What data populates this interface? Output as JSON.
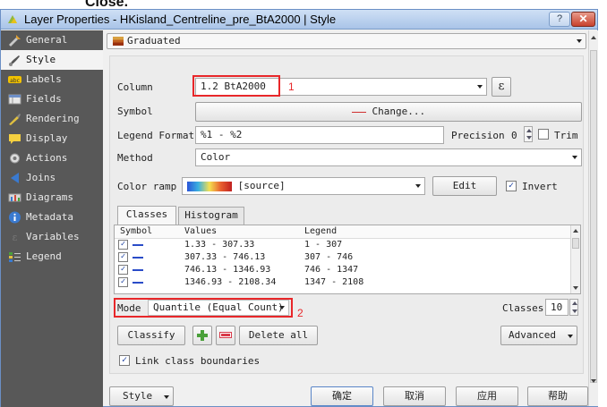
{
  "top_label": "Close.",
  "window": {
    "title": "Layer Properties - HKisland_Centreline_pre_BtA2000 | Style",
    "help": "?",
    "close": "✕"
  },
  "sidebar": {
    "items": [
      {
        "label": "General",
        "icon": "general-icon"
      },
      {
        "label": "Style",
        "icon": "style-icon"
      },
      {
        "label": "Labels",
        "icon": "labels-icon"
      },
      {
        "label": "Fields",
        "icon": "fields-icon"
      },
      {
        "label": "Rendering",
        "icon": "rendering-icon"
      },
      {
        "label": "Display",
        "icon": "display-icon"
      },
      {
        "label": "Actions",
        "icon": "actions-icon"
      },
      {
        "label": "Joins",
        "icon": "joins-icon"
      },
      {
        "label": "Diagrams",
        "icon": "diagrams-icon"
      },
      {
        "label": "Metadata",
        "icon": "metadata-icon"
      },
      {
        "label": "Variables",
        "icon": "variables-icon"
      },
      {
        "label": "Legend",
        "icon": "legend-icon"
      }
    ],
    "active_index": 1
  },
  "renderer": {
    "label": "Graduated"
  },
  "form": {
    "column_label": "Column",
    "column_value": "1.2 BtA2000",
    "epsilon": "ε",
    "symbol_label": "Symbol",
    "change_button": "Change...",
    "legend_format_label": "Legend Format",
    "legend_format_value": "%1 - %2",
    "precision_label": "Precision",
    "precision_value": "0",
    "trim_label": "Trim",
    "method_label": "Method",
    "method_value": "Color",
    "color_ramp_label": "Color ramp",
    "color_ramp_value": "[source]",
    "edit_button": "Edit",
    "invert_label": "Invert"
  },
  "annotations": {
    "n1": "1",
    "n2": "2"
  },
  "tabs": [
    {
      "label": "Classes"
    },
    {
      "label": "Histogram"
    }
  ],
  "classes_table": {
    "headers": [
      "Symbol",
      "Values",
      "Legend"
    ],
    "rows": [
      {
        "values": "1.33 - 307.33",
        "legend": "1 - 307"
      },
      {
        "values": "307.33 - 746.13",
        "legend": "307 - 746"
      },
      {
        "values": "746.13 - 1346.93",
        "legend": "746 - 1347"
      },
      {
        "values": "1346.93 - 2108.34",
        "legend": "1347 - 2108"
      }
    ]
  },
  "mode": {
    "label": "Mode",
    "value": "Quantile (Equal Count)",
    "classes_label": "Classes",
    "classes_value": "10"
  },
  "actions": {
    "classify": "Classify",
    "delete_all": "Delete all",
    "advanced": "Advanced"
  },
  "link_boundaries": "Link class boundaries",
  "bottom": {
    "style": "Style",
    "ok": "确定",
    "cancel": "取消",
    "apply": "应用",
    "help": "帮助"
  },
  "colors": {
    "annotation_red": "#e8272a",
    "sidebar_bg": "#585858",
    "symbol_blue": "#2a4cc8"
  }
}
